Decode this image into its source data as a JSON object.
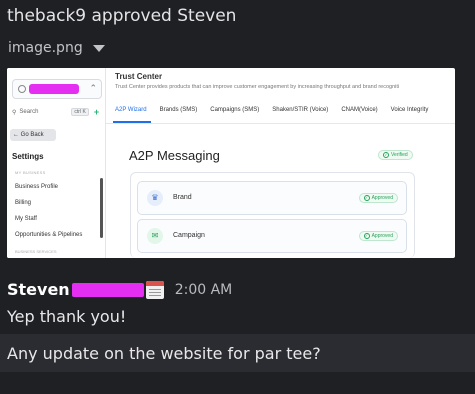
{
  "system_message": "theback9 approved Steven",
  "attachment": {
    "filename": "image.png",
    "toggle_icon": "caret-down-icon"
  },
  "screenshot": {
    "sidebar": {
      "search_label": "Search",
      "search_shortcut": "ctrl K",
      "go_back": "← Go Back",
      "section_title": "Settings",
      "group_caption": "MY BUSINESS",
      "items": [
        "Business Profile",
        "Billing",
        "My Staff",
        "Opportunities & Pipelines"
      ],
      "group_caption_2": "BUSINESS SERVICES"
    },
    "main": {
      "title": "Trust Center",
      "subtitle": "Trust Center provides products that can improve customer engagement by increasing throughput and brand recogniti",
      "tabs": [
        "A2P Wizard",
        "Brands (SMS)",
        "Campaigns (SMS)",
        "Shaken/STIR (Voice)",
        "CNAM(Voice)",
        "Voice Integrity"
      ],
      "section_heading": "A2P Messaging",
      "verified_label": "Verified",
      "cards": [
        {
          "label": "Brand",
          "status": "Approved"
        },
        {
          "label": "Campaign",
          "status": "Approved"
        }
      ]
    }
  },
  "message": {
    "author": "Steven",
    "timestamp": "2:00 AM",
    "text": "Yep thank you!"
  },
  "reply": {
    "text": "Any update on the website for par tee?"
  },
  "colors": {
    "background": "#1f2024",
    "redaction": "#e42ef2",
    "accent_blue": "#1f6feb",
    "approved_green": "#27a35a"
  }
}
